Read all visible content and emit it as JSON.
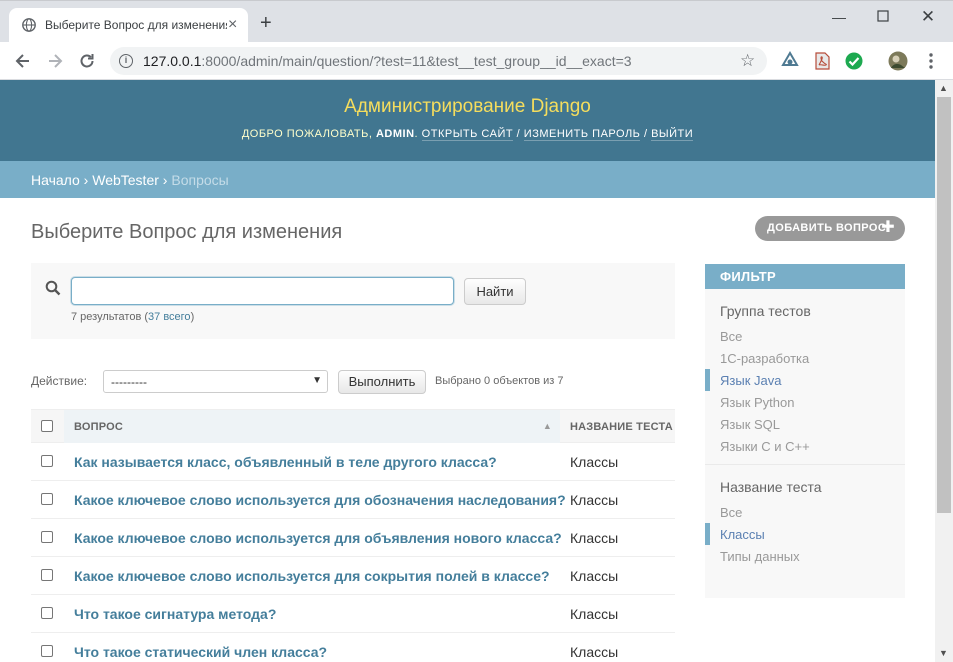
{
  "browser": {
    "tab_title": "Выберите Вопрос для изменения",
    "url_host": "127.0.0.1",
    "url_rest": ":8000/admin/main/question/?test=11&test__test_group__id__exact=3"
  },
  "header": {
    "site_title": "Администрирование Django",
    "welcome": "ДОБРО ПОЖАЛОВАТЬ,",
    "user": "ADMIN",
    "open_site": "ОТКРЫТЬ САЙТ",
    "change_password": "ИЗМЕНИТЬ ПАРОЛЬ",
    "logout": "ВЫЙТИ"
  },
  "breadcrumbs": {
    "home": "Начало",
    "app": "WebTester",
    "current": "Вопросы"
  },
  "content": {
    "title": "Выберите Вопрос для изменения",
    "add_button": "ДОБАВИТЬ ВОПРОС"
  },
  "search": {
    "value": "",
    "button": "Найти",
    "results_prefix": "7 результатов (",
    "total_link": "37 всего",
    "results_suffix": ")"
  },
  "actions": {
    "label": "Действие:",
    "selected": "---------",
    "run": "Выполнить",
    "counter": "Выбрано 0 объектов из 7"
  },
  "table": {
    "columns": [
      "ВОПРОС",
      "НАЗВАНИЕ ТЕСТА"
    ],
    "rows": [
      {
        "question": "Как называется класс, объявленный в теле другого класса?",
        "test": "Классы"
      },
      {
        "question": "Какое ключевое слово используется для обозначения наследования?",
        "test": "Классы"
      },
      {
        "question": "Какое ключевое слово используется для объявления нового класса?",
        "test": "Классы"
      },
      {
        "question": "Какое ключевое слово используется для сокрытия полей в классе?",
        "test": "Классы"
      },
      {
        "question": "Что такое сигнатура метода?",
        "test": "Классы"
      },
      {
        "question": "Что такое статический член класса?",
        "test": "Классы"
      }
    ]
  },
  "filter": {
    "title": "ФИЛЬТР",
    "groups": [
      {
        "title": "Группа тестов",
        "items": [
          "Все",
          "1С-разработка",
          "Язык Java",
          "Язык Python",
          "Язык SQL",
          "Языки С и С++"
        ],
        "selected_index": 2
      },
      {
        "title": "Название теста",
        "items": [
          "Все",
          "Классы",
          "Типы данных"
        ],
        "selected_index": 1
      }
    ]
  }
}
